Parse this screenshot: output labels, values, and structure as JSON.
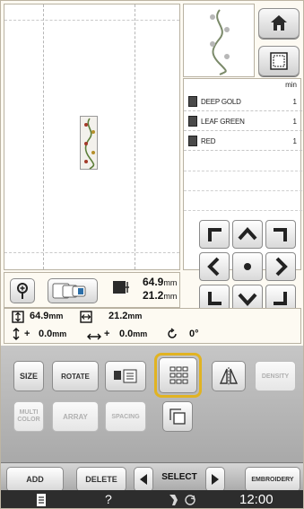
{
  "hoop_icon": "hoop-grid-icon",
  "thread_colors": [
    {
      "name": "DEEP GOLD",
      "count": "1"
    },
    {
      "name": "LEAF GREEN",
      "count": "1"
    },
    {
      "name": "RED",
      "count": "1"
    }
  ],
  "thread_header": "min",
  "pattern_size": {
    "width": "64.9",
    "width_unit": "mm",
    "height": "21.2",
    "height_unit": "mm"
  },
  "dimensions": {
    "width": "64.9",
    "width_unit": "mm",
    "height": "21.2",
    "height_unit": "mm"
  },
  "position": {
    "x_sign": "+",
    "x": "0.0",
    "x_unit": "mm",
    "y_sign": "+",
    "y": "0.0",
    "y_unit": "mm",
    "rotation": "0°"
  },
  "buttons": {
    "size": "SIZE",
    "rotate": "ROTATE",
    "density": "DENSITY",
    "multi_color": "MULTI COLOR",
    "array": "ARRAY",
    "spacing": "SPACING",
    "add": "ADD",
    "delete": "DELETE",
    "select": "SELECT",
    "embroidery": "EMBROIDERY"
  },
  "clock": "12:00",
  "help_label": "?",
  "colors": {
    "highlight": "#e1b322",
    "status_bar": "#2d2d2d"
  }
}
